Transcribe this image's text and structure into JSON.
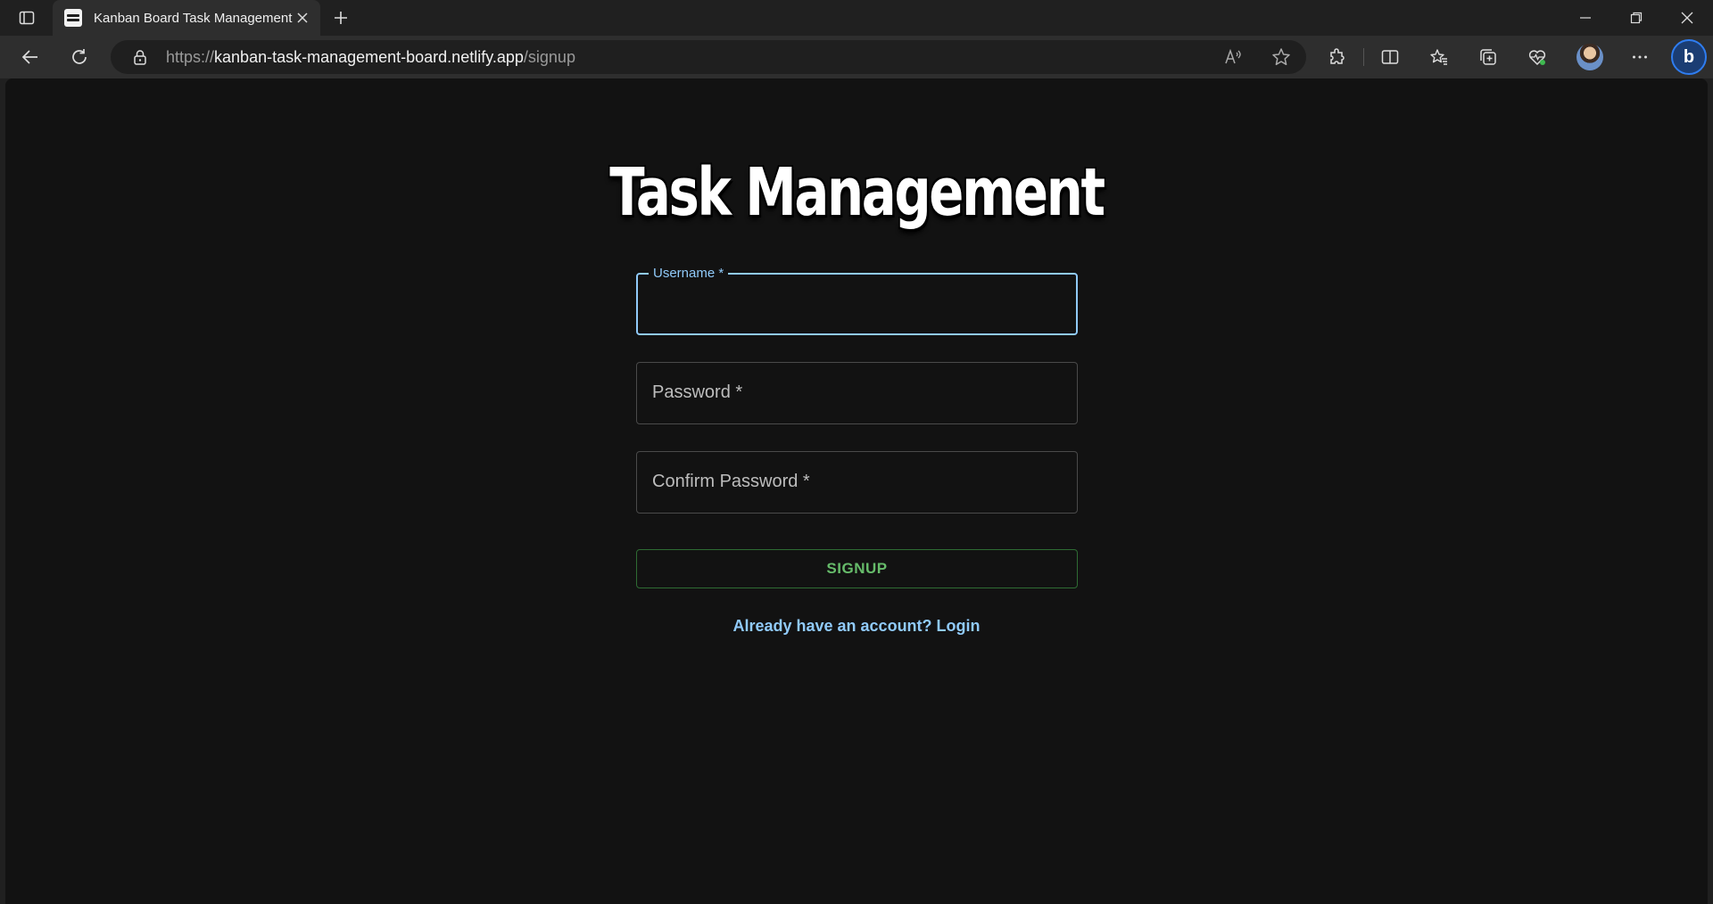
{
  "browser": {
    "tab_title": "Kanban Board Task Management",
    "url_prefix": "https://",
    "url_host": "kanban-task-management-board.netlify.app",
    "url_path": "/signup"
  },
  "page": {
    "title": "Task Management",
    "username_label": "Username *",
    "username_value": "",
    "password_label": "Password *",
    "confirm_password_label": "Confirm Password *",
    "signup_label": "SIGNUP",
    "login_link": "Already have an account? Login"
  },
  "colors": {
    "background": "#121212",
    "accent_blue": "#90caf9",
    "accent_green": "#66bb6a"
  },
  "icons": [
    "tab-actions-icon",
    "close-icon",
    "plus-icon",
    "minimize-icon",
    "restore-icon",
    "back-icon",
    "refresh-icon",
    "lock-icon",
    "read-aloud-icon",
    "star-icon",
    "extensions-icon",
    "split-screen-icon",
    "favorites-icon",
    "collections-icon",
    "browser-essentials-icon",
    "more-icon",
    "copilot-icon"
  ]
}
